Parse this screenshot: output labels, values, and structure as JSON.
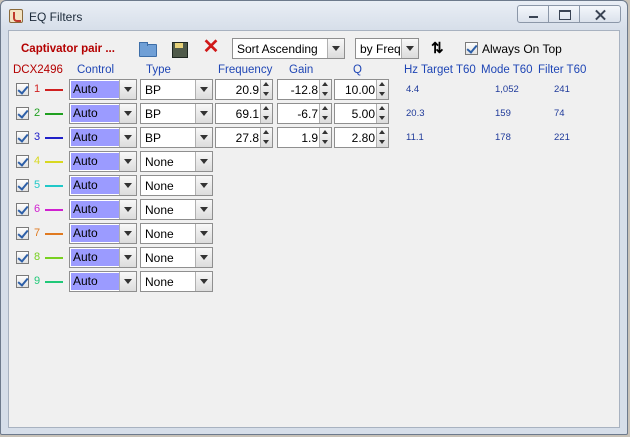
{
  "window": {
    "title": "EQ Filters"
  },
  "toolbar": {
    "pair_name": "Captivator pair ...",
    "sort_order": "Sort Ascending",
    "sort_by": "by Freq",
    "always_on_top_label": "Always On Top",
    "always_on_top_checked": true
  },
  "headers": {
    "device": "DCX2496",
    "control": "Control",
    "type": "Type",
    "frequency": "Frequency",
    "gain": "Gain",
    "q": "Q",
    "hz": "Hz",
    "target_t60": "Target T60",
    "mode_t60": "Mode T60",
    "filter_t60": "Filter T60"
  },
  "filters": [
    {
      "num": "1",
      "color": "#d02020",
      "enabled": true,
      "control": "Auto",
      "type": "BP",
      "frequency": "20.9",
      "gain": "-12.8",
      "q": "10.00",
      "hz": "4.4",
      "mode_t60": "1,052",
      "filter_t60": "241"
    },
    {
      "num": "2",
      "color": "#20a020",
      "enabled": true,
      "control": "Auto",
      "type": "BP",
      "frequency": "69.1",
      "gain": "-6.7",
      "q": "5.00",
      "hz": "20.3",
      "mode_t60": "159",
      "filter_t60": "74"
    },
    {
      "num": "3",
      "color": "#2020c8",
      "enabled": true,
      "control": "Auto",
      "type": "BP",
      "frequency": "27.8",
      "gain": "1.9",
      "q": "2.80",
      "hz": "11.1",
      "mode_t60": "178",
      "filter_t60": "221"
    },
    {
      "num": "4",
      "color": "#d8d820",
      "enabled": true,
      "control": "Auto",
      "type": "None"
    },
    {
      "num": "5",
      "color": "#20c8c8",
      "enabled": true,
      "control": "Auto",
      "type": "None"
    },
    {
      "num": "6",
      "color": "#d020d0",
      "enabled": true,
      "control": "Auto",
      "type": "None"
    },
    {
      "num": "7",
      "color": "#e07a20",
      "enabled": true,
      "control": "Auto",
      "type": "None"
    },
    {
      "num": "8",
      "color": "#78d020",
      "enabled": true,
      "control": "Auto",
      "type": "None"
    },
    {
      "num": "9",
      "color": "#20c878",
      "enabled": true,
      "control": "Auto",
      "type": "None"
    }
  ]
}
